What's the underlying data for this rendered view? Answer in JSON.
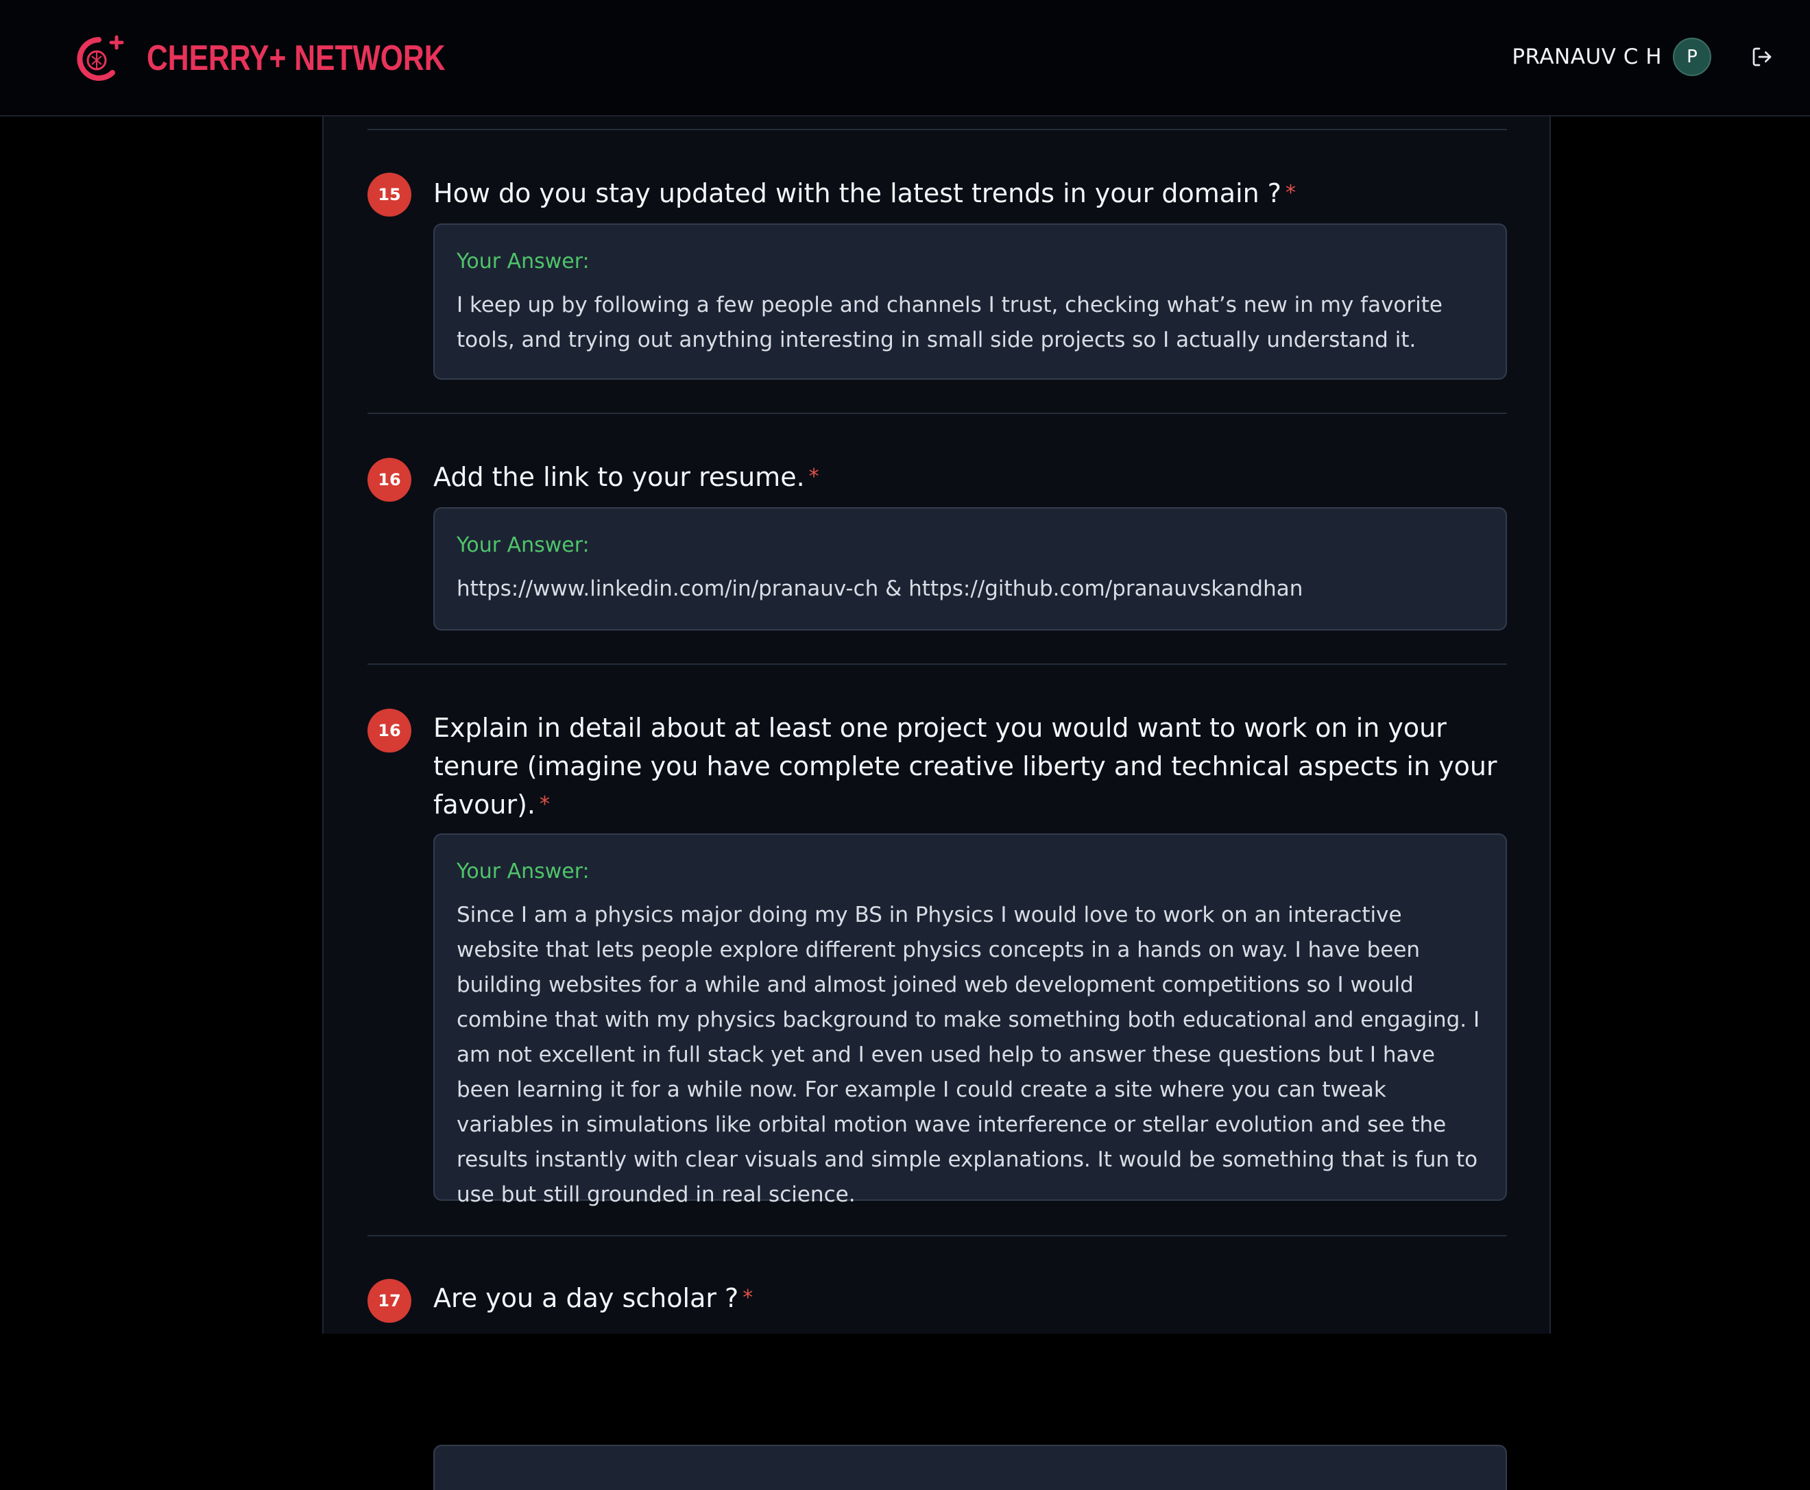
{
  "header": {
    "brand_name": "CHERRY+ NETWORK",
    "user_name": "PRANAUV C H",
    "avatar_initial": "P",
    "brand_color": "#e8335a"
  },
  "questions": [
    {
      "number": "15",
      "title": "How do you stay updated with the latest trends in your domain ?",
      "required": "*",
      "answer_label": "Your Answer:",
      "answer": "I keep up by following a few people and channels I trust, checking what’s new in my favorite tools, and trying out anything interesting in small side projects so I actually understand it."
    },
    {
      "number": "16",
      "title": "Add the link to your resume.",
      "required": "*",
      "answer_label": "Your Answer:",
      "answer": "https://www.linkedin.com/in/pranauv-ch & https://github.com/pranauvskandhan"
    },
    {
      "number": "16",
      "title": "Explain in detail about at least one project you would want to work on in your tenure (imagine you have complete creative liberty and technical aspects in your favour).",
      "required": "*",
      "answer_label": "Your Answer:",
      "answer": "Since I am a physics major doing my BS in Physics I would love to work on an interactive website that lets people explore different physics concepts in a hands on way. I have been building websites for a while and almost joined web development competitions so I would combine that with my physics background to make something both educational and engaging. I am not excellent in full stack yet and I even used help to answer these questions but I have been learning it for a while now. For example I could create a site where you can tweak variables in simulations like orbital motion wave interference or stellar evolution and see the results instantly with clear visuals and simple explanations. It would be something that is fun to use but still grounded in real science."
    },
    {
      "number": "17",
      "title": "Are you a day scholar ?",
      "required": "*"
    }
  ]
}
